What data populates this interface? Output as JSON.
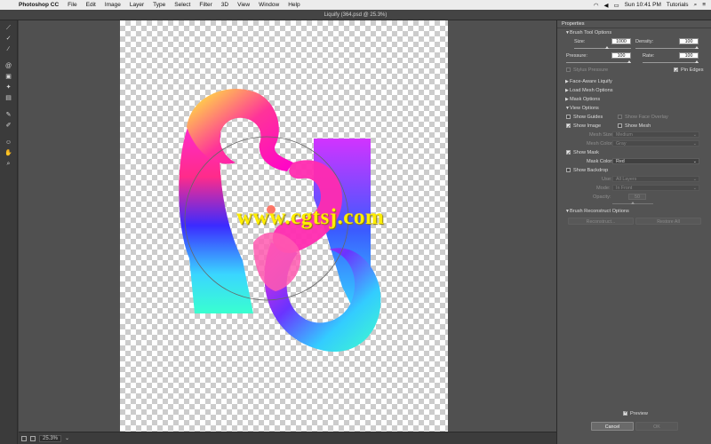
{
  "menubar": {
    "app_name": "Photoshop CC",
    "items": [
      "File",
      "Edit",
      "Image",
      "Layer",
      "Type",
      "Select",
      "Filter",
      "3D",
      "View",
      "Window",
      "Help"
    ],
    "clock": "Sun 10:41 PM",
    "user": "Tutorials"
  },
  "window": {
    "title": "Liquify (364.psd @ 25.3%)"
  },
  "canvas": {
    "watermark": "www.cgtsj.com"
  },
  "status": {
    "zoom": "25.3%"
  },
  "panel": {
    "header": "Properties",
    "brush_tool_options": {
      "title": "Brush Tool Options",
      "size_label": "Size:",
      "size_value": "1000",
      "density_label": "Density:",
      "density_value": "100",
      "pressure_label": "Pressure:",
      "pressure_value": "100",
      "rate_label": "Rate:",
      "rate_value": "100",
      "stylus_pressure_label": "Stylus Pressure",
      "pin_edges_label": "Pin Edges"
    },
    "face_aware": {
      "title": "Face-Aware Liquify"
    },
    "load_mesh": {
      "title": "Load Mesh Options"
    },
    "mask_options": {
      "title": "Mask Options"
    },
    "view_options": {
      "title": "View Options",
      "show_guides": "Show Guides",
      "show_face_overlay": "Show Face Overlay",
      "show_image": "Show Image",
      "show_mesh": "Show Mesh",
      "mesh_size_label": "Mesh Size:",
      "mesh_size_value": "Medium",
      "mesh_color_label": "Mesh Color:",
      "mesh_color_value": "Gray",
      "show_mask": "Show Mask",
      "mask_color_label": "Mask Color:",
      "mask_color_value": "Red",
      "show_backdrop": "Show Backdrop",
      "use_label": "Use:",
      "use_value": "All Layers",
      "mode_label": "Mode:",
      "mode_value": "In Front",
      "opacity_label": "Opacity:",
      "opacity_value": "50"
    },
    "reconstruct": {
      "title": "Brush Reconstruct Options",
      "reconstruct_button": "Reconstruct...",
      "restore_all_button": "Restore All"
    },
    "preview_label": "Preview",
    "cancel_button": "Cancel",
    "ok_button": "OK"
  }
}
